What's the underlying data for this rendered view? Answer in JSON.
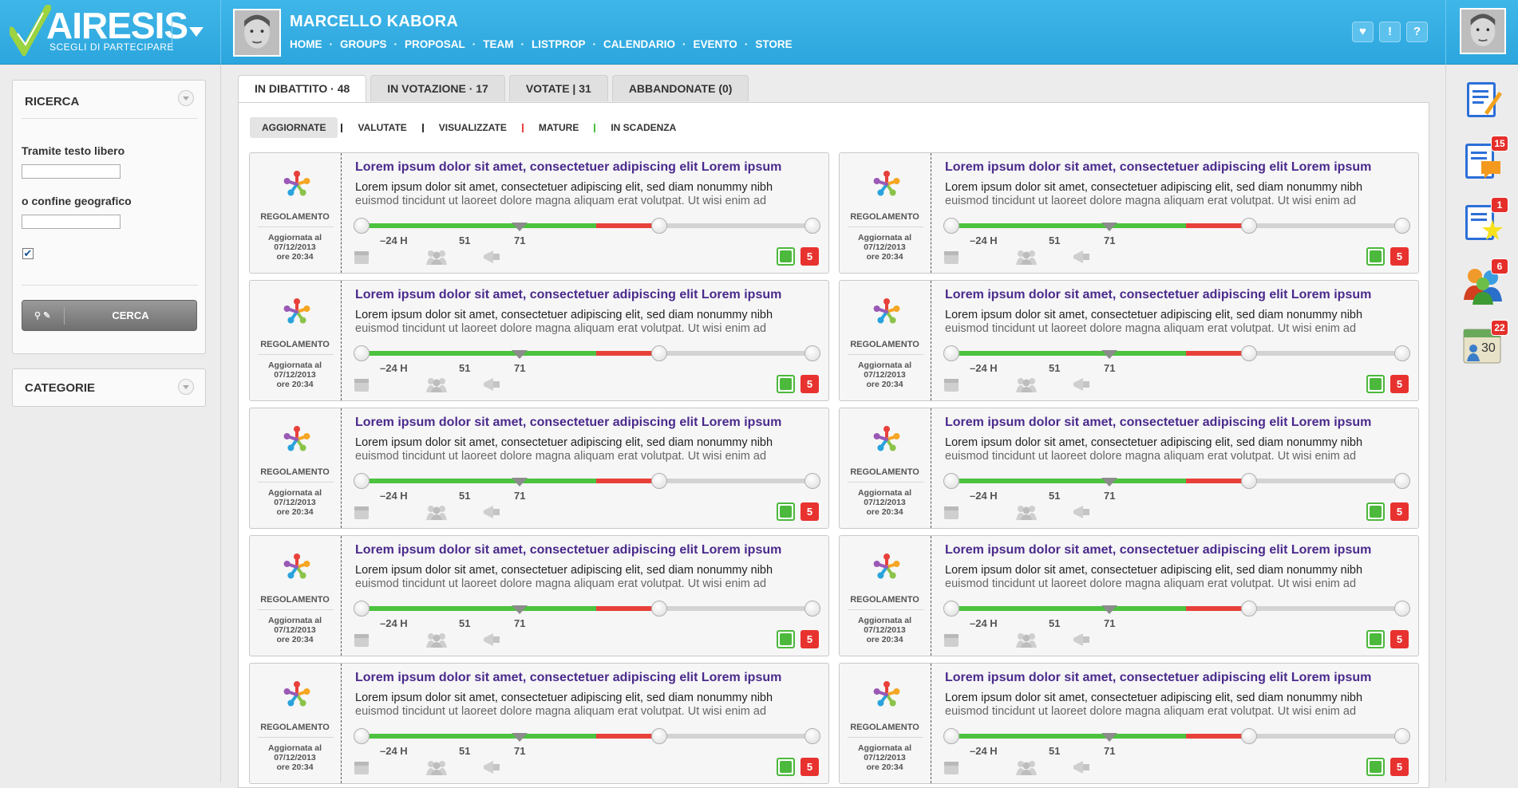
{
  "header": {
    "logo_text": "AIRESIS",
    "logo_tagline": "SCEGLI DI PARTECIPARE",
    "user_name": "MARCELLO KABORA",
    "nav": [
      "HOME",
      "GROUPS",
      "PROPOSAL",
      "TEAM",
      "LISTPROP",
      "CALENDARIO",
      "EVENTO",
      "STORE"
    ],
    "nav_separator": "·",
    "buttons": [
      {
        "icon": "heart-icon",
        "glyph": "♥"
      },
      {
        "icon": "alert-icon",
        "glyph": "!"
      },
      {
        "icon": "help-icon",
        "glyph": "?"
      }
    ]
  },
  "sidebar": {
    "search_panel": {
      "title": "RICERCA",
      "text_label": "Tramite testo libero",
      "text_value": "",
      "geo_label": "o confine geografico",
      "geo_value": "",
      "checkbox_checked": true,
      "checkbox_glyph": "✔",
      "button_icons": "⚲ ✎",
      "button_label": "CERCA"
    },
    "categories_panel": {
      "title": "CATEGORIE"
    }
  },
  "tabs": [
    {
      "label": "IN DIBATTITO · 48",
      "active": true
    },
    {
      "label": "IN VOTAZIONE · 17",
      "active": false
    },
    {
      "label": "VOTATE | 31",
      "active": false
    },
    {
      "label": "ABBANDONATE (0)",
      "active": false
    }
  ],
  "subtabs": [
    {
      "label": "AGGIORNATE",
      "active": true,
      "sep_color": "#333333"
    },
    {
      "label": "VALUTATE",
      "active": false,
      "sep_color": "#333333"
    },
    {
      "label": "VISUALIZZATE",
      "active": false,
      "sep_color": "#e8413b"
    },
    {
      "label": "MATURE",
      "active": false,
      "sep_color": "#4cc23f"
    },
    {
      "label": "IN SCADENZA",
      "active": false,
      "sep_color": null
    }
  ],
  "proposal_template": {
    "category": "REGOLAMENTO",
    "date_line1": "Aggiornata al",
    "date_line2": "07/12/2013",
    "date_line3": "ore 20:34",
    "title": "Lorem ipsum dolor sit amet, consectetuer adipiscing elit Lorem ipsum",
    "excerpt_line1": "Lorem ipsum dolor sit amet, consectetuer adipiscing elit, sed diam nonummy nibh",
    "excerpt_line2": "euismod tincidunt ut laoreet dolore magna aliquam erat volutpat. Ut wisi enim ad",
    "timeline_labels": [
      "–24 H",
      "51",
      "71"
    ],
    "timeline": {
      "green_fraction": 0.52,
      "red_fraction": 0.14,
      "marker_fraction": 0.35
    },
    "icons": [
      "calendar-icon",
      "people-icon",
      "megaphone-icon"
    ],
    "votes": "5"
  },
  "proposal_count": 10,
  "colors": {
    "accent": "#2ca6de",
    "title": "#4a2a8c",
    "green": "#4cc23f",
    "red": "#e8413b"
  },
  "right_sidebar": [
    {
      "name": "proposals-icon",
      "badge": null
    },
    {
      "name": "comments-icon",
      "badge": "15"
    },
    {
      "name": "new-proposals-icon",
      "badge": "1"
    },
    {
      "name": "groups-icon",
      "badge": "6"
    },
    {
      "name": "calendar-events-icon",
      "badge": "22",
      "glyph": "30"
    }
  ]
}
